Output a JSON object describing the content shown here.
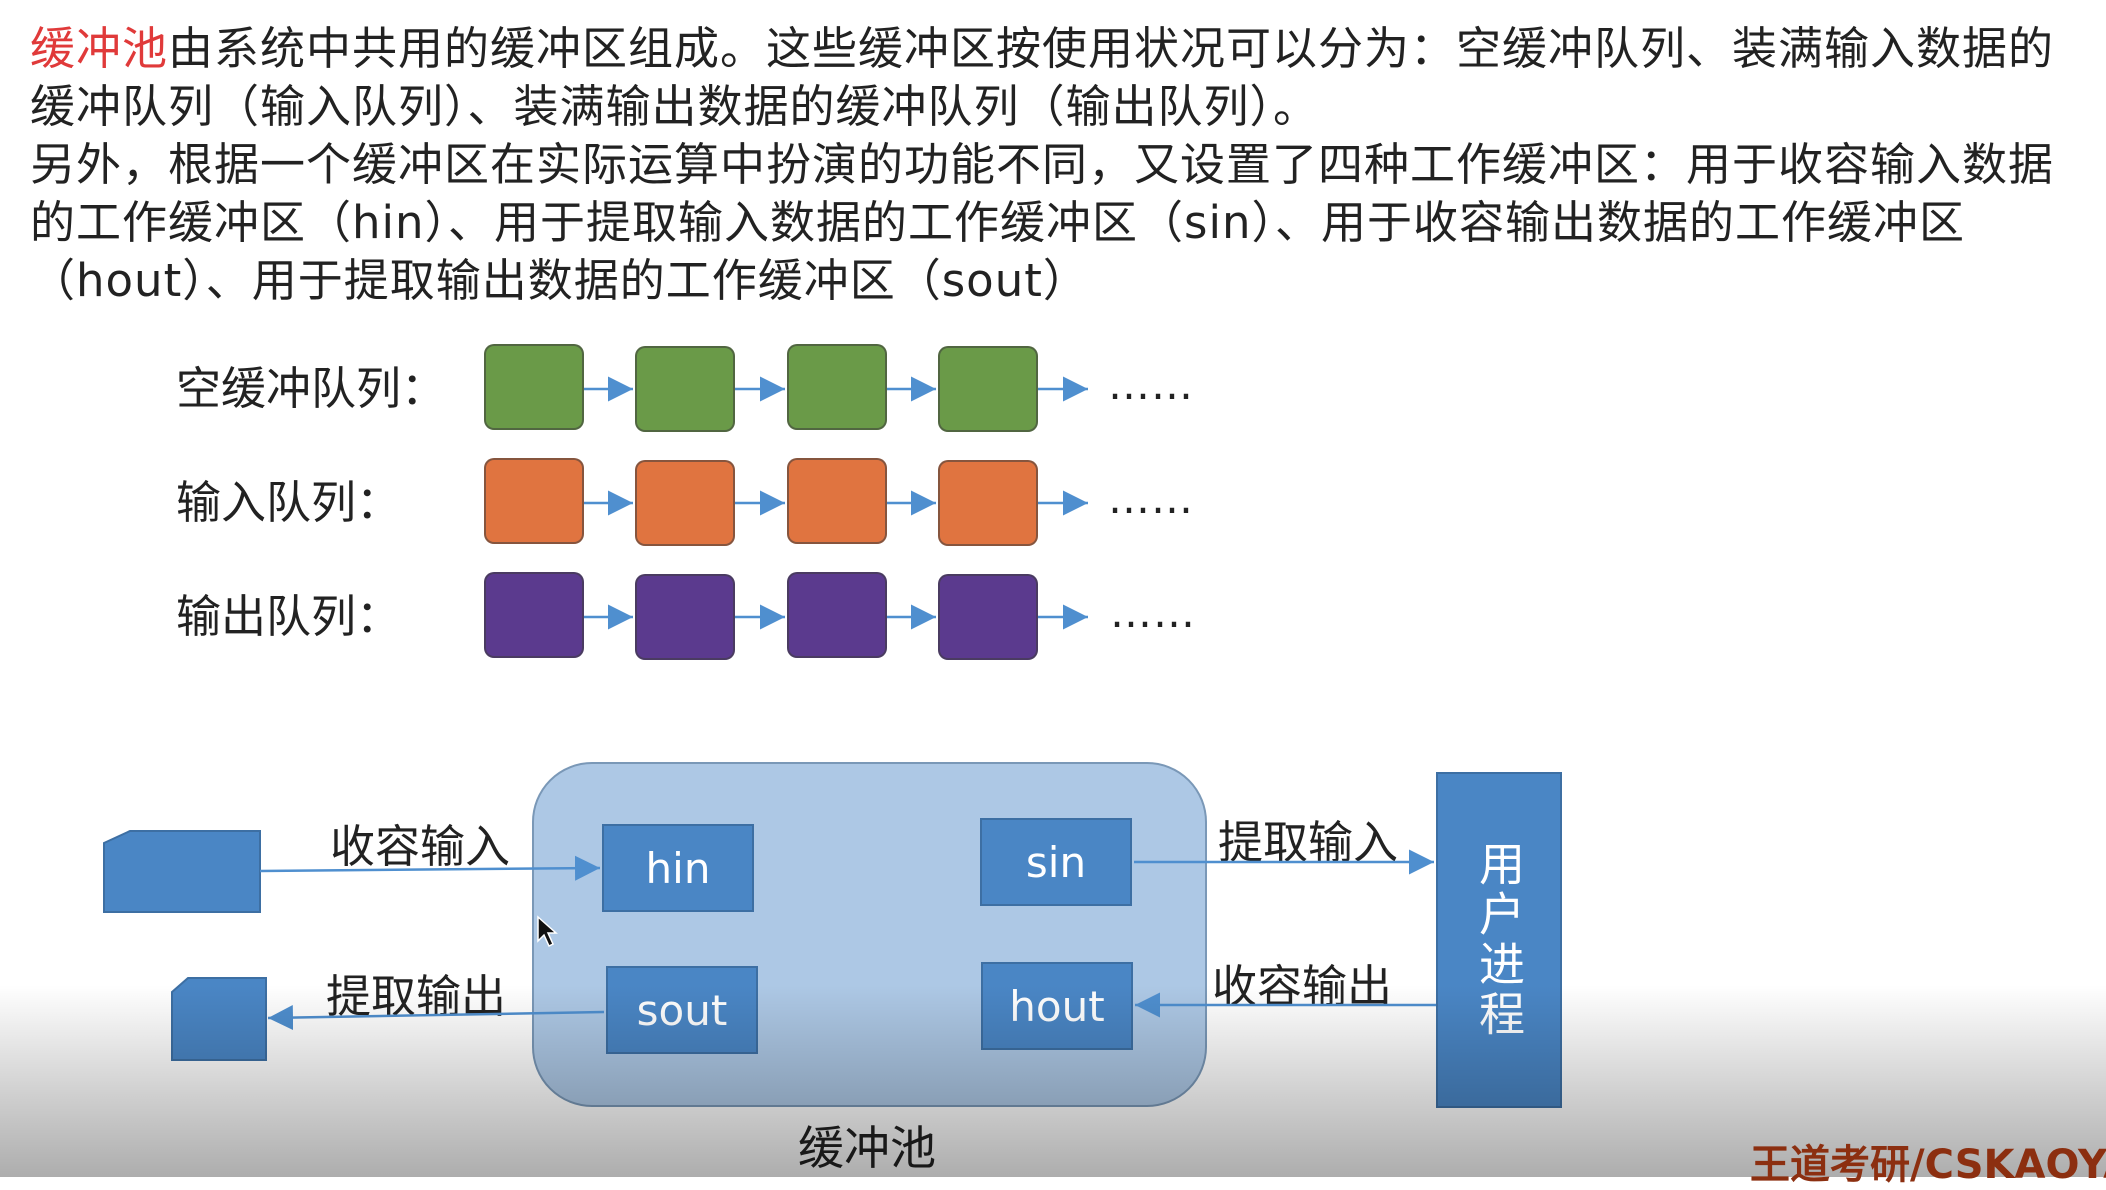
{
  "intro": {
    "highlight": "缓冲池",
    "p1": "由系统中共用的缓冲区组成。这些缓冲区按使用状况可以分为：空缓冲队列、装满输入数据的缓冲队列（输入队列）、装满输出数据的缓冲队列（输出队列）。",
    "p2": "另外，根据一个缓冲区在实际运算中扮演的功能不同，又设置了四种工作缓冲区：用于收容输入数据的工作缓冲区（hin）、用于提取输入数据的工作缓冲区（sin）、用于收容输出数据的工作缓冲区（hout）、用于提取输出数据的工作缓冲区（sout）"
  },
  "queues": [
    {
      "label": "空缓冲队列：",
      "color": "#6a9a48",
      "blocks": 4,
      "ellipsis": "……"
    },
    {
      "label": "输入队列：",
      "color": "#e07440",
      "blocks": 4,
      "ellipsis": "……"
    },
    {
      "label": "输出队列：",
      "color": "#5b3a8e",
      "blocks": 4,
      "ellipsis": "……"
    }
  ],
  "diagram": {
    "pool_label": "缓冲池",
    "hin": "hin",
    "sin": "sin",
    "sout": "sout",
    "hout": "hout",
    "collect_input": "收容输入",
    "extract_input": "提取输入",
    "extract_output": "提取输出",
    "collect_output": "收容输出",
    "user_process": "用户进程"
  },
  "colors": {
    "highlight": "#e03a3a",
    "box": "#4a86c5",
    "pool": "#adc8e5",
    "arrow": "#4f8fcf"
  },
  "watermark": "王道考研/CSKAOYAN"
}
